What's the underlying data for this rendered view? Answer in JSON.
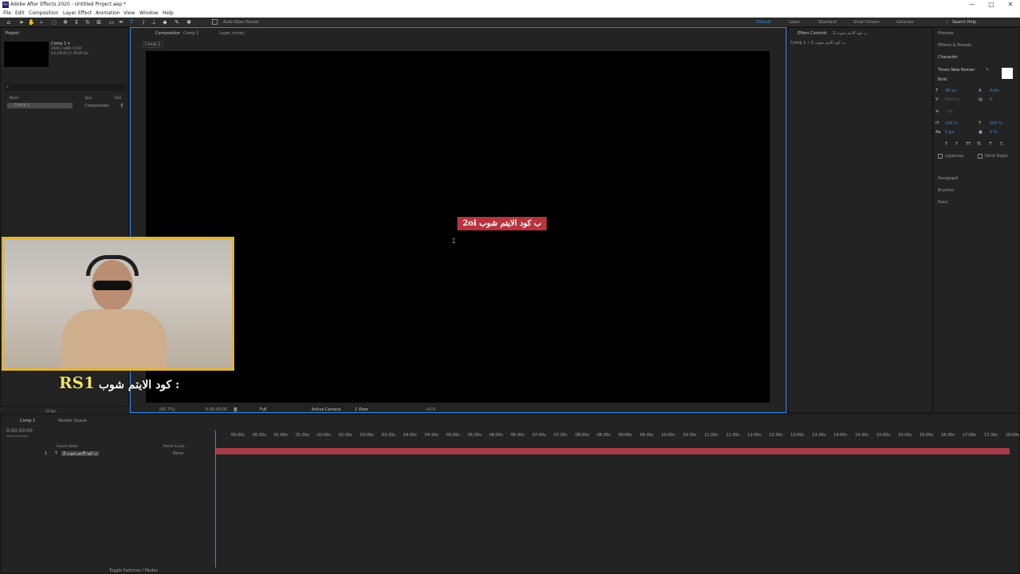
{
  "window": {
    "title": "Adobe After Effects 2020 - Untitled Project.aep *",
    "app_icon": "Ae",
    "controls": {
      "minimize": "—",
      "maximize": "▢",
      "close": "✕"
    }
  },
  "menu": [
    "File",
    "Edit",
    "Composition",
    "Layer",
    "Effect",
    "Animation",
    "View",
    "Window",
    "Help"
  ],
  "toolbar": {
    "auto_open_label": "Auto-Open Panels",
    "workspaces": [
      "Default",
      "Learn",
      "Standard",
      "Small Screen",
      "Libraries"
    ],
    "active_workspace": "Default",
    "search_placeholder": "Search Help"
  },
  "project_panel": {
    "tab": "Project",
    "selected_item": "Comp 1 ▾",
    "info_line1": "1920 x 1080 (1.00)",
    "info_line2": "Δ 0;18:25;17, 60.00 fps",
    "search_icon": "⌕",
    "columns": [
      "Name",
      "Type",
      "Size"
    ],
    "items": [
      {
        "name": "Comp 1",
        "type": "Composition"
      }
    ],
    "bpc": "32 bpc"
  },
  "composition_panel": {
    "tab_prefix": "Composition",
    "tab_name": "Comp 1",
    "layer_tab": "Layer (none)",
    "breadcrumb": "Comp 1",
    "text_layer": "ب كود الايتم شوب 2oi",
    "footer": {
      "zoom": "(81.7%)",
      "timecode": "0:00:00:00",
      "resolution": "Full",
      "camera": "Active Camera",
      "view": "1 View",
      "exposure": "+0.0"
    }
  },
  "effect_controls": {
    "tab": "Effect Controls",
    "tab_target": "ب كود الايتم شوب 2",
    "breadcrumb": "Comp 1 • ب كود الايتم شوب 2"
  },
  "right_panels": {
    "preview": "Preview",
    "effects_presets": "Effects & Presets",
    "character": "Character",
    "font": "Times New Roman",
    "style": "Bold",
    "size": "36 px",
    "leading": "Auto",
    "kerning": "Metrics",
    "tracking": "0",
    "stroke": "- px",
    "v_scale": "100 %",
    "h_scale": "100 %",
    "baseline": "0 px",
    "tsume": "0 %",
    "format_buttons": [
      "T",
      "T",
      "TT",
      "Tt",
      "T'",
      "T,"
    ],
    "ligatures": "Ligatures",
    "hindi_digits": "Hindi Digits",
    "paragraph": "Paragraph",
    "brushes": "Brushes",
    "paint": "Paint"
  },
  "timeline": {
    "tab": "Comp 1",
    "render_queue": "Render Queue",
    "current_time": "0:00:00:00",
    "sub_time": "00000 (60.00 fps)",
    "columns": {
      "source_name": "Source Name",
      "parent": "Parent & Link"
    },
    "layer": {
      "number": "1",
      "name": "ب كود الايتم شوب 2",
      "parent": "None"
    },
    "ticks": [
      "00:00s",
      "00:30s",
      "01:00s",
      "01:30s",
      "02:00s",
      "02:30s",
      "03:00s",
      "03:30s",
      "04:00s",
      "04:30s",
      "05:00s",
      "05:30s",
      "06:00s",
      "06:30s",
      "07:00s",
      "07:30s",
      "08:00s",
      "08:30s",
      "09:00s",
      "09:30s",
      "10:00s",
      "10:30s",
      "11:00s",
      "11:30s",
      "12:00s",
      "12:30s",
      "13:00s",
      "13:30s",
      "14:00s",
      "14:30s",
      "15:00s",
      "15:30s",
      "16:00s",
      "16:30s",
      "17:00s",
      "17:30s",
      "18:00s"
    ],
    "toggle_label": "Toggle Switches / Modes"
  },
  "overlay": {
    "arabic": "كود الايتم شوب :",
    "code": "RS1"
  },
  "colors": {
    "accent": "#2d8ceb",
    "layer_bar": "#a63b48",
    "text_layer_bg": "#b7333e",
    "webcam_frame": "#e0b533"
  }
}
